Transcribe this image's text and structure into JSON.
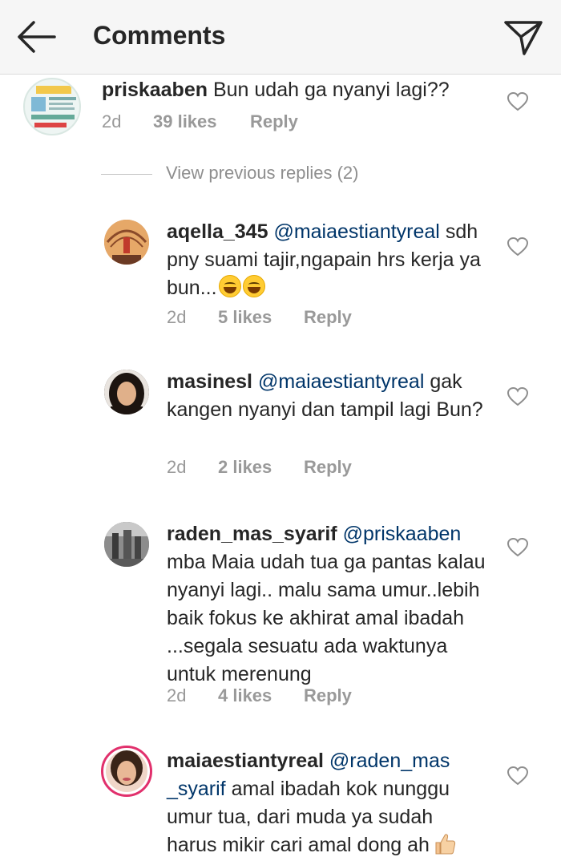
{
  "header": {
    "title": "Comments",
    "back_icon": "arrow-left-icon",
    "send_icon": "send-icon"
  },
  "colors": {
    "header_bg": "#f6f6f6",
    "text": "#262626",
    "meta": "#999999",
    "mention": "#003569"
  },
  "parent_comment": {
    "username": "priskaaben",
    "text": " Bun udah ga nyanyi lagi??",
    "time": "2d",
    "likes": "39 likes",
    "reply": "Reply"
  },
  "view_previous": "View previous replies (2)",
  "replies": [
    {
      "username": "aqella_345",
      "mention": "@maiaestiantyreal",
      "text": "sdh pny suami tajir,ngapain hrs kerja ya bun...",
      "time": "2d",
      "likes": "5 likes",
      "reply": "Reply"
    },
    {
      "username": "masinesl",
      "mention": "@maiaestiantyreal",
      "text": " gak kangen nyanyi dan tampil lagi Bun?",
      "time": "2d",
      "likes": "2 likes",
      "reply": "Reply"
    },
    {
      "username": "raden_mas_syarif",
      "mention": "@priskaaben",
      "text": "mba Maia udah tua ga pantas kalau nyanyi lagi.. malu sama umur..lebih baik fokus ke akhirat amal ibadah ...segala sesuatu ada waktunya untuk merenung",
      "time": "2d",
      "likes": "4 likes",
      "reply": "Reply"
    },
    {
      "username": "maiaestiantyreal",
      "mention": "@raden_mas _syarif",
      "text": " amal ibadah kok nunggu umur tua, dari muda ya sudah harus mikir cari amal dong ah",
      "time": "",
      "likes": "",
      "reply": ""
    }
  ]
}
